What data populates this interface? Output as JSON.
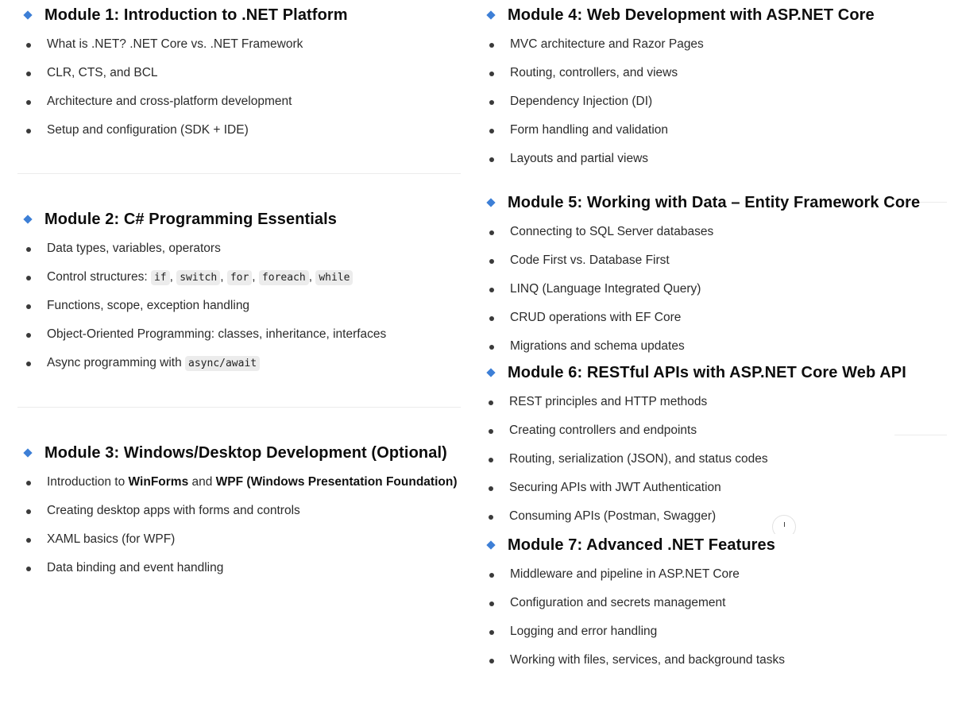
{
  "modules": [
    {
      "title": "Module 1: Introduction to .NET Platform",
      "items": [
        "What is .NET? .NET Core vs. .NET Framework",
        "CLR, CTS, and BCL",
        "Architecture and cross-platform development",
        "Setup and configuration (SDK + IDE)"
      ]
    },
    {
      "title": "Module 2: C# Programming Essentials",
      "items": {
        "i0": "Data types, variables, operators",
        "i1_prefix": "Control structures: ",
        "code_if": "if",
        "code_switch": "switch",
        "code_for": "for",
        "code_foreach": "foreach",
        "code_while": "while",
        "sep": ",",
        "i2": "Functions, scope, exception handling",
        "i3": "Object-Oriented Programming: classes, inheritance, interfaces",
        "i4_prefix": "Async programming with ",
        "code_async": "async/await"
      }
    },
    {
      "title": "Module 3: Windows/Desktop Development (Optional)",
      "items": {
        "i0_a": "Introduction to ",
        "i0_b": "WinForms",
        "i0_c": " and ",
        "i0_d": "WPF (Windows Presentation Foundation)",
        "i1": "Creating desktop apps with forms and controls",
        "i2": "XAML basics (for WPF)",
        "i3": "Data binding and event handling"
      }
    },
    {
      "title": "Module 4: Web Development with ASP.NET Core",
      "items": [
        "MVC architecture and Razor Pages",
        "Routing, controllers, and views",
        "Dependency Injection (DI)",
        "Form handling and validation",
        "Layouts and partial views"
      ]
    },
    {
      "title": "Module 5: Working with Data – Entity Framework Core",
      "items": [
        "Connecting to SQL Server databases",
        "Code First vs. Database First",
        "LINQ (Language Integrated Query)",
        "CRUD operations with EF Core",
        "Migrations and schema updates"
      ]
    },
    {
      "title": "Module 6: RESTful APIs with ASP.NET Core Web API",
      "items": [
        "REST principles and HTTP methods",
        "Creating controllers and endpoints",
        "Routing, serialization (JSON), and status codes",
        "Securing APIs with JWT Authentication",
        "Consuming APIs (Postman, Swagger)"
      ]
    },
    {
      "title": "Module 7: Advanced .NET Features",
      "items": [
        "Middleware and pipeline in ASP.NET Core",
        "Configuration and secrets management",
        "Logging and error handling",
        "Working with files, services, and background tasks"
      ]
    }
  ],
  "colors": {
    "accent_diamond": "#3d7fd6",
    "divider": "#ececec",
    "code_bg": "#ececec"
  }
}
